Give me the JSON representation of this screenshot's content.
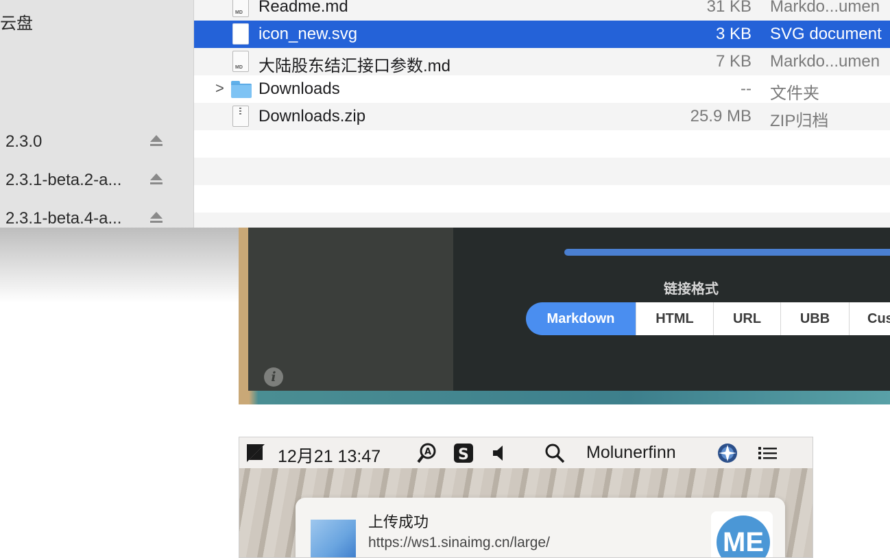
{
  "sidebar": {
    "cloud_label": "云盘",
    "volumes": [
      {
        "label": "2.3.0"
      },
      {
        "label": "2.3.1-beta.2-a..."
      },
      {
        "label": "2.3.1-beta.4-a..."
      }
    ]
  },
  "files": [
    {
      "name": "Readme.md",
      "size": "31 KB",
      "kind": "Markdo...umen",
      "icon": "md-file-icon",
      "badge": "MD"
    },
    {
      "name": "icon_new.svg",
      "size": "3 KB",
      "kind": "SVG document",
      "icon": "svg-file-icon",
      "selected": true
    },
    {
      "name": "大陆股东结汇接口参数.md",
      "size": "7 KB",
      "kind": "Markdo...umen",
      "icon": "md-file-icon",
      "badge": "MD"
    },
    {
      "name": "Downloads",
      "size": "--",
      "kind": "文件夹",
      "icon": "folder-icon",
      "disclosure": ">"
    },
    {
      "name": "Downloads.zip",
      "size": "25.9 MB",
      "kind": "ZIP归档",
      "icon": "zip-file-icon"
    }
  ],
  "colors": {
    "selection": "#2462d8",
    "accent_blue": "#4a8ef0"
  },
  "uploader": {
    "info_icon": "i",
    "link_format_label": "链接格式",
    "formats": [
      "Markdown",
      "HTML",
      "URL",
      "UBB",
      "Cus"
    ],
    "selected_format": "Markdown"
  },
  "menubar": {
    "datetime": "12月21 13:47",
    "username": "Molunerfinn",
    "icons": [
      "picgo-icon",
      "tool-icon",
      "s-app-icon",
      "volume-icon",
      "search-icon",
      "user-globe-icon",
      "list-icon"
    ]
  },
  "notification": {
    "title": "上传成功",
    "url": "https://ws1.sinaimg.cn/large/",
    "logo_text": "ME"
  }
}
